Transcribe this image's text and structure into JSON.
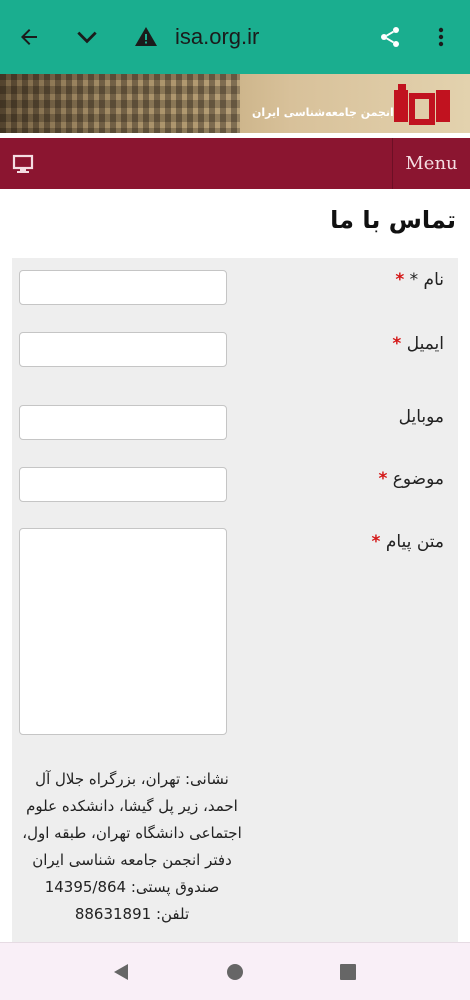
{
  "browser": {
    "url": "isa.org.ir",
    "icons": [
      "back-arrow-icon",
      "chevron-down-icon",
      "warning-icon",
      "share-icon",
      "more-vert-icon"
    ]
  },
  "banner": {
    "society_name": "انجمن جامعه‌شناسی ایران"
  },
  "navbar": {
    "menu_label": "Menu",
    "color": "#8b1530"
  },
  "page": {
    "title": "تماس با ما"
  },
  "form": {
    "name_label": "نام *",
    "email_label": "ایمیل",
    "mobile_label": "موبایل",
    "subject_label": "موضوع",
    "message_label": "متن پیام",
    "required_mark": "*"
  },
  "contact": {
    "address": "نشانی: تهران، بزرگراه جلال آل احمد، زیر پل گیشا، دانشکده علوم اجتماعی دانشگاه تهران، طبقه اول، دفتر انجمن جامعه شناسی ایران",
    "po_box": "صندوق پستی: 14395/864",
    "phone": "تلفن: 88631891"
  }
}
